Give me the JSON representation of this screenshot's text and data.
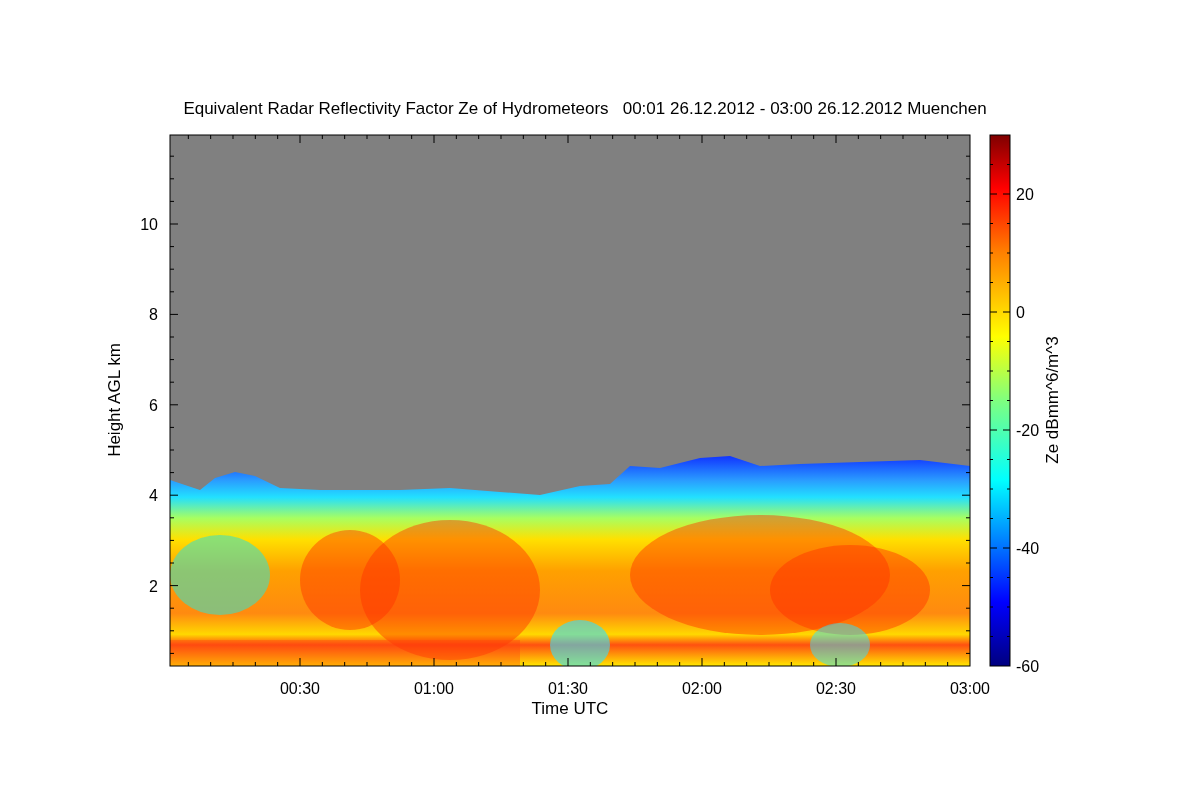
{
  "title": "Equivalent Radar Reflectivity Factor Ze of Hydrometeors   00:01 26.12.2012 - 03:00 26.12.2012 Muenchen",
  "x_axis": {
    "label": "Time UTC",
    "ticks": [
      "00:30",
      "01:00",
      "01:30",
      "02:00",
      "02:30",
      "03:00"
    ]
  },
  "y_axis": {
    "label": "Height AGL km",
    "ticks": [
      "10",
      "8",
      "6",
      "4",
      "2"
    ]
  },
  "colorbar": {
    "label": "Ze dBmm^6/m^3",
    "ticks": [
      "20",
      "0",
      "-20",
      "-40",
      "-60"
    ]
  }
}
